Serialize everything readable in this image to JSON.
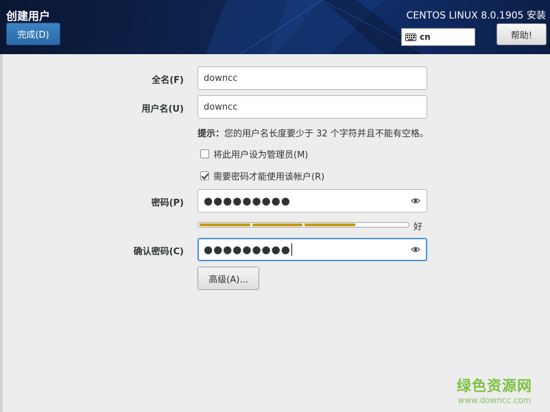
{
  "header": {
    "title": "创建用户",
    "done_label": "完成(D)",
    "product": "CENTOS LINUX 8.0.1905 安装",
    "keyboard_layout": "cn",
    "help_label": "帮助!"
  },
  "form": {
    "fullname_label": "全名(F)",
    "fullname_value": "downcc",
    "username_label": "用户名(U)",
    "username_value": "downcc",
    "hint_prefix": "提示：",
    "hint_text": "您的用户名长度要少于 32 个字符并且不能有空格。",
    "admin_checkbox_label": "将此用户设为管理员(M)",
    "admin_checked": false,
    "require_password_label": "需要密码才能使用该帐户(R)",
    "require_password_checked": true,
    "password_label": "密码(P)",
    "password_value": "●●●●●●●●●",
    "strength_level": 0.75,
    "strength_label": "好",
    "confirm_label": "确认密码(C)",
    "confirm_value": "●●●●●●●●●",
    "advanced_label": "高级(A)..."
  },
  "icons": {
    "keyboard": "keyboard-icon",
    "reveal": "eye-icon"
  },
  "colors": {
    "header_bg": "#0f2552",
    "done_button": "#2c6aa8",
    "strength_bar": "#c59b12",
    "focus": "#4a90d9"
  },
  "watermark": {
    "line1": "绿色资源网",
    "line2": "www.downcc.com"
  }
}
